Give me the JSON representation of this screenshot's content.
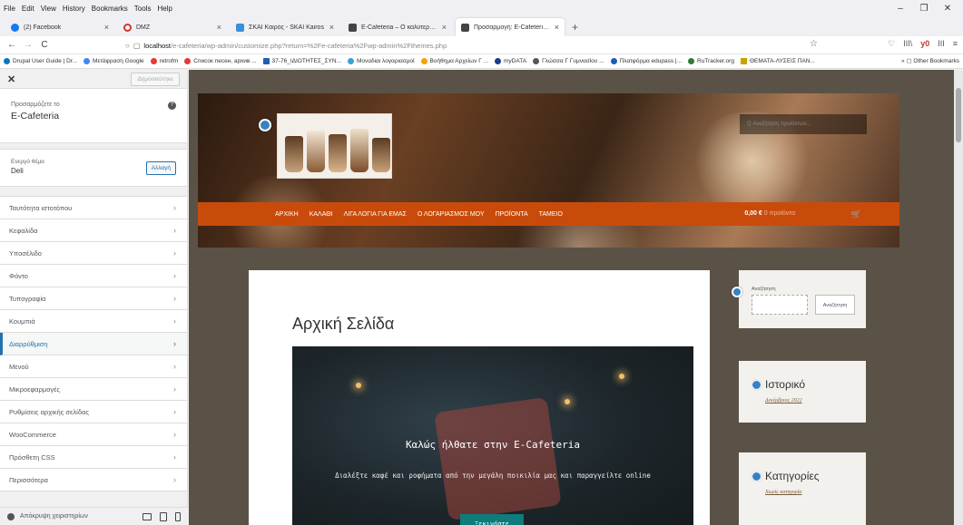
{
  "menubar": {
    "items": [
      "File",
      "Edit",
      "View",
      "History",
      "Bookmarks",
      "Tools",
      "Help"
    ]
  },
  "window_controls": {
    "minimize": "–",
    "maximize": "❐",
    "close": "✕"
  },
  "tabs": [
    {
      "title": "(2) Facebook",
      "color": "#1877f2"
    },
    {
      "title": "DMZ",
      "color": "#d0342c"
    },
    {
      "title": "ΣΚΑΙ Καιρός - SKAI Kairos",
      "color": "#3a8fd8"
    },
    {
      "title": "E-Cafeteria – Ο καλύτερος καφ...",
      "color": "#444444"
    },
    {
      "title": "Προσαρμογή: E-Cafeteria – Ο...",
      "color": "#444444"
    }
  ],
  "new_tab": "+",
  "nav": {
    "back": "←",
    "forward": "→",
    "reload": "C",
    "url_host": "localhost",
    "url_rest": "/e-cafeteria/wp-admin/customize.php?return=%2Fe-cafeteria%2Fwp-admin%2Fthemes.php",
    "star": "☆",
    "right_icons": [
      "♡",
      "III\\",
      "y0",
      "III",
      "≡"
    ]
  },
  "bookmarks": [
    {
      "label": "Drupal User Guide | Dr...",
      "color": "#0678be"
    },
    {
      "label": "Μετάφραση Google",
      "color": "#4285f4"
    },
    {
      "label": "retrofm",
      "color": "#e53935"
    },
    {
      "label": "Список песен, архив ...",
      "color": "#e53935"
    },
    {
      "label": "37-76_ΙΔΙΟΤΗΤΕΣ_ΣΥΝ...",
      "color": "#1e5fb4"
    },
    {
      "label": "Μοναδιαι λογαριασμοί",
      "color": "#3aa0d8"
    },
    {
      "label": "Βοήθημα Αρχείων Γ ...",
      "color": "#f4a300"
    },
    {
      "label": "myDATA",
      "color": "#1e3a8a"
    },
    {
      "label": "Γλώσσα Γ Γυμνασίου ...",
      "color": "#555555"
    },
    {
      "label": "Πλατφόρμα edupass |...",
      "color": "#1e5fb4"
    },
    {
      "label": "RuTracker.org",
      "color": "#2e7d32"
    },
    {
      "label": "ΘΕΜΑΤΑ-ΛΥΣΕΙΣ ΠΑΝ...",
      "color": "#c8a400"
    }
  ],
  "bookmarks_other": "Other Bookmarks",
  "sidebar": {
    "close": "✕",
    "publish": "Δημοσιεύτηκε",
    "customizing_small": "Προσαρμόζετε το",
    "site_name": "E-Cafeteria",
    "help": "?",
    "active_theme_small": "Ενεργό θέμα",
    "active_theme": "Deli",
    "change": "Αλλαγή",
    "items": [
      "Ταυτότητα ιστοτόπου",
      "Κεφαλίδα",
      "Υποσέλιδο",
      "Φόντο",
      "Τυπογραφία",
      "Κουμπιά",
      "Διαρρύθμιση",
      "Μενού",
      "Μικροεφαρμογές",
      "Ρυθμίσεις αρχικής σελίδας",
      "WooCommerce",
      "Πρόσθετη CSS",
      "Περισσότερα"
    ],
    "active_index": 6,
    "chevron": "›",
    "hide_controls": "Απόκρυψη χειριστηρίων"
  },
  "site": {
    "search_placeholder": "Q Αναζήτηση προϊόντων...",
    "menu": [
      "ΑΡΧΙΚΗ",
      "ΚΑΛΑΘΙ",
      "ΛΙΓΑ ΛΟΓΙΑ ΓΙΑ ΕΜΑΣ",
      "Ο ΛΟΓΑΡΙΑΣΜΟΣ ΜΟΥ",
      "ΠΡΟΪΟΝΤΑ",
      "ΤΑΜΕΙΟ"
    ],
    "cart_total": "0,00 €",
    "cart_label": "0 προϊόντα",
    "page_title": "Αρχική Σελίδα",
    "banner_title": "Καλώς ήλθατε στην E-Cafeteria",
    "banner_sub": "Διαλέξτε καφέ και ροφήματα από την μεγάλη ποικιλία μας και παραγγείλτε online",
    "banner_button": "Ξεκινήστε",
    "widget_search_label": "Αναζήτηση",
    "widget_search_button": "Αναζήτηση",
    "history_title": "Ιστορικό",
    "history_link": "Δεκέμβριος 2022",
    "categories_title": "Κατηγορίες",
    "categories_link": "Χωρίς κατηγορία"
  },
  "colors": {
    "nav_orange": "#c94b0b",
    "wp_blue": "#2271b1",
    "button_teal": "#0e7c7b"
  }
}
